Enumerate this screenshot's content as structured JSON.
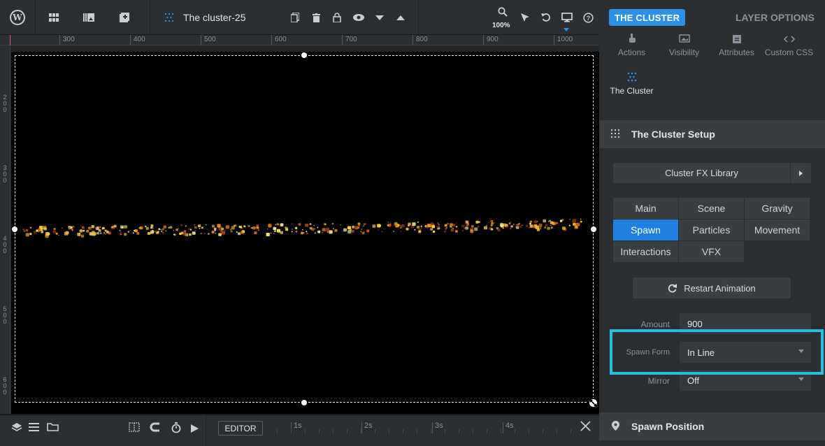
{
  "toolbar": {
    "wp_logo": "W",
    "doc_title": "The cluster-25",
    "zoom": "100%"
  },
  "ruler": {
    "top_labels": [
      "300",
      "400",
      "500",
      "600",
      "700",
      "800",
      "900",
      "1000"
    ],
    "left_labels": [
      "200",
      "300",
      "400",
      "500",
      "600"
    ]
  },
  "timeline": {
    "editor_label": "EDITOR",
    "marks": [
      "1s",
      "2s",
      "3s",
      "4s"
    ]
  },
  "panel": {
    "pill": "THE CLUSTER",
    "layer_options": "LAYER OPTIONS",
    "tabs": [
      {
        "label": "Actions",
        "icon": "hand-pointer-icon"
      },
      {
        "label": "Visibility",
        "icon": "image-icon"
      },
      {
        "label": "Attributes",
        "icon": "clipboard-icon"
      },
      {
        "label": "Custom CSS",
        "icon": "code-icon"
      }
    ],
    "cluster_tab": "The Cluster",
    "setup_section": "The Cluster Setup",
    "fx_library": "Cluster FX Library",
    "subtabs": [
      "Main",
      "Scene",
      "Gravity",
      "Spawn",
      "Particles",
      "Movement",
      "Interactions",
      "VFX"
    ],
    "active_subtab": "Spawn",
    "restart_label": "Restart Animation",
    "fields": {
      "amount": {
        "label": "Amount",
        "value": "900"
      },
      "spawn_form": {
        "label": "Spawn Form",
        "value": "In Line"
      },
      "mirror": {
        "label": "Mirror",
        "value": "Off"
      }
    },
    "spawn_position": "Spawn Position"
  },
  "colors": {
    "accent": "#2e8fe6",
    "highlight": "#26c0dc",
    "panel_bg": "#2b2e33"
  }
}
